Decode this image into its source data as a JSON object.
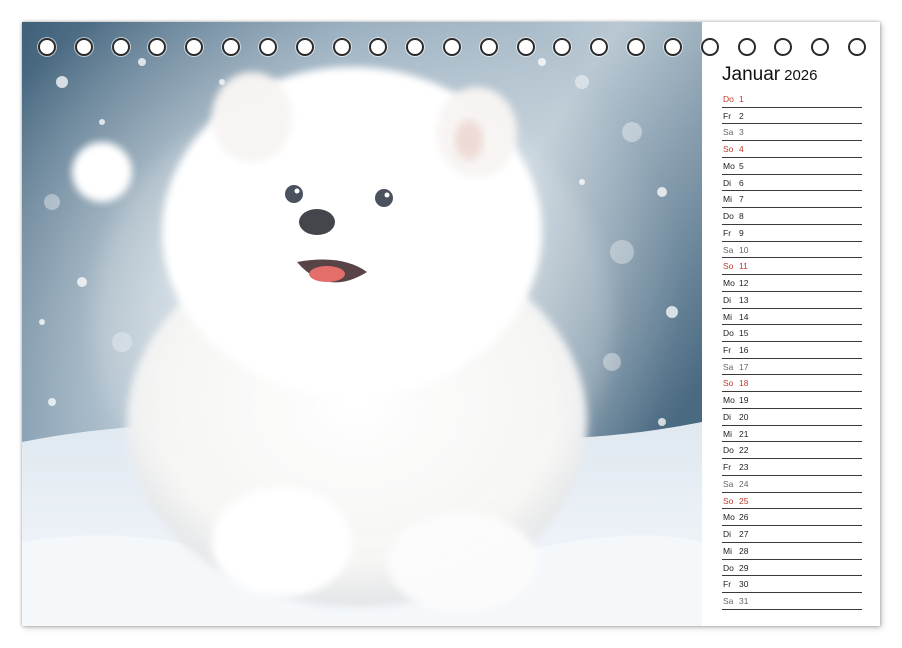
{
  "calendar": {
    "month": "Januar",
    "year": "2026",
    "ring_count": 23,
    "colors": {
      "sunday": "#c0392b",
      "saturday": "#666666",
      "weekday": "#222222",
      "line": "#3a3a3a"
    },
    "days": [
      {
        "weekday": "Do",
        "day": "1",
        "type": "sun"
      },
      {
        "weekday": "Fr",
        "day": "2",
        "type": "weekday"
      },
      {
        "weekday": "Sa",
        "day": "3",
        "type": "sat"
      },
      {
        "weekday": "So",
        "day": "4",
        "type": "sun"
      },
      {
        "weekday": "Mo",
        "day": "5",
        "type": "weekday"
      },
      {
        "weekday": "Di",
        "day": "6",
        "type": "weekday"
      },
      {
        "weekday": "Mi",
        "day": "7",
        "type": "weekday"
      },
      {
        "weekday": "Do",
        "day": "8",
        "type": "weekday"
      },
      {
        "weekday": "Fr",
        "day": "9",
        "type": "weekday"
      },
      {
        "weekday": "Sa",
        "day": "10",
        "type": "sat"
      },
      {
        "weekday": "So",
        "day": "11",
        "type": "sun"
      },
      {
        "weekday": "Mo",
        "day": "12",
        "type": "weekday"
      },
      {
        "weekday": "Di",
        "day": "13",
        "type": "weekday"
      },
      {
        "weekday": "Mi",
        "day": "14",
        "type": "weekday"
      },
      {
        "weekday": "Do",
        "day": "15",
        "type": "weekday"
      },
      {
        "weekday": "Fr",
        "day": "16",
        "type": "weekday"
      },
      {
        "weekday": "Sa",
        "day": "17",
        "type": "sat"
      },
      {
        "weekday": "So",
        "day": "18",
        "type": "sun"
      },
      {
        "weekday": "Mo",
        "day": "19",
        "type": "weekday"
      },
      {
        "weekday": "Di",
        "day": "20",
        "type": "weekday"
      },
      {
        "weekday": "Mi",
        "day": "21",
        "type": "weekday"
      },
      {
        "weekday": "Do",
        "day": "22",
        "type": "weekday"
      },
      {
        "weekday": "Fr",
        "day": "23",
        "type": "weekday"
      },
      {
        "weekday": "Sa",
        "day": "24",
        "type": "sat"
      },
      {
        "weekday": "So",
        "day": "25",
        "type": "sun"
      },
      {
        "weekday": "Mo",
        "day": "26",
        "type": "weekday"
      },
      {
        "weekday": "Di",
        "day": "27",
        "type": "weekday"
      },
      {
        "weekday": "Mi",
        "day": "28",
        "type": "weekday"
      },
      {
        "weekday": "Do",
        "day": "29",
        "type": "weekday"
      },
      {
        "weekday": "Fr",
        "day": "30",
        "type": "weekday"
      },
      {
        "weekday": "Sa",
        "day": "31",
        "type": "sat"
      }
    ]
  },
  "photo": {
    "subject": "fluffy-white-puppy-in-snow",
    "colors": {
      "sky": "#5d7d96",
      "snow": "#eef3f8",
      "fur": "#ffffff"
    }
  }
}
